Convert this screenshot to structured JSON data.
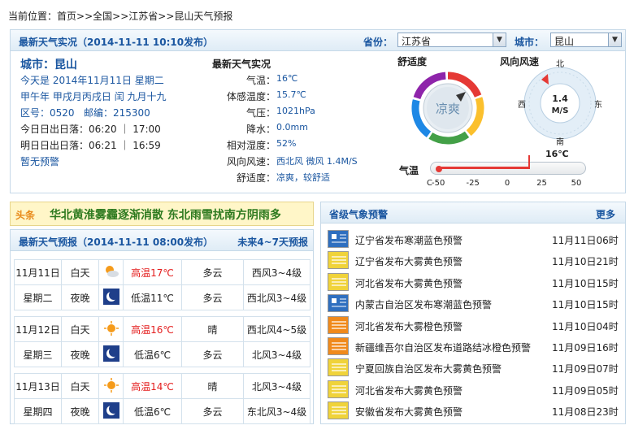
{
  "breadcrumb": {
    "prefix": "当前位置：",
    "home": "首页",
    "sep1": ">>",
    "country": "全国",
    "sep2": ">>",
    "province": "江苏省",
    "sep3": ">>",
    "current": "昆山天气预报"
  },
  "realtime": {
    "title": "最新天气实况（2014-11-11  10:10发布）",
    "province_label": "省份：",
    "province_value": "江苏省",
    "city_label": "城市：",
    "city_value": "昆山",
    "city_name": "城市：昆山",
    "today_label": "今天是",
    "today_date": "2014年11月11日",
    "today_week": "星期二",
    "lunar_year": "甲午年",
    "lunar_date": "甲戌月丙戌日",
    "lunar_leap": "闰",
    "lunar_md": "九月十九",
    "areacode": "区号：0520",
    "postcode": "邮编：215300",
    "sun_today": "今日日出日落：06:20 ｜ 17:00",
    "sun_tomorrow": "明日日出日落：06:21 ｜ 16:59",
    "no_warning": "暂无预警",
    "obs_title": "最新天气实况",
    "obs": [
      {
        "k": "气温：",
        "v": "16℃"
      },
      {
        "k": "体感温度：",
        "v": "15.7℃"
      },
      {
        "k": "气压：",
        "v": "1021hPa"
      },
      {
        "k": "降水：",
        "v": "0.0mm"
      },
      {
        "k": "相对湿度：",
        "v": "52%"
      },
      {
        "k": "风向风速：",
        "v": "西北风 微风 1.4M/S"
      },
      {
        "k": "舒适度：",
        "v": "凉爽，较舒适"
      }
    ],
    "comfort_title": "舒适度",
    "comfort_value": "凉爽",
    "wind_title": "风向风速",
    "wind_speed": "1.4",
    "wind_unit": "M/S",
    "dir_n": "北",
    "dir_s": "南",
    "dir_w": "西",
    "dir_e": "东",
    "temp_title": "气温",
    "temp_value": "16℃",
    "temp_unit": "C",
    "temp_ticks": [
      "-50",
      "-25",
      "0",
      "25",
      "50"
    ],
    "temp_level": 16,
    "comfort_colors": [
      "#e53935",
      "#fbc02d",
      "#43a047",
      "#1e88e5",
      "#8e24aa"
    ]
  },
  "marquee": {
    "tag": "头条",
    "text": "华北黄淮雾霾逐渐消散  东北雨雪扰南方阴雨多"
  },
  "forecast": {
    "title": "最新天气预报（2014-11-11  08:00发布）",
    "link": "未来4~7天预报",
    "days": [
      {
        "date": "11月11日",
        "week": "星期二",
        "day": {
          "label": "白天",
          "icon": "sun-cloud-icon",
          "temp": "高温17℃",
          "wx": "多云",
          "wind": "西风3~4级"
        },
        "night": {
          "label": "夜晚",
          "icon": "moon-icon",
          "temp": "低温11℃",
          "wx": "多云",
          "wind": "西北风3~4级"
        }
      },
      {
        "date": "11月12日",
        "week": "星期三",
        "day": {
          "label": "白天",
          "icon": "sun-icon",
          "temp": "高温16℃",
          "wx": "晴",
          "wind": "西北风4~5级"
        },
        "night": {
          "label": "夜晚",
          "icon": "moon-icon",
          "temp": "低温6℃",
          "wx": "多云",
          "wind": "北风3~4级"
        }
      },
      {
        "date": "11月13日",
        "week": "星期四",
        "day": {
          "label": "白天",
          "icon": "sun-icon",
          "temp": "高温14℃",
          "wx": "晴",
          "wind": "北风3~4级"
        },
        "night": {
          "label": "夜晚",
          "icon": "moon-icon",
          "temp": "低温6℃",
          "wx": "多云",
          "wind": "东北风3~4级"
        }
      }
    ]
  },
  "warnings": {
    "title": "省级气象预警",
    "more": "更多",
    "items": [
      {
        "icon": "cold-wave-blue-icon",
        "color": "#2f6fbf",
        "text": "辽宁省发布寒潮蓝色预警",
        "time": "11月11日06时"
      },
      {
        "icon": "fog-yellow-icon",
        "color": "#f0d33a",
        "text": "辽宁省发布大雾黄色预警",
        "time": "11月10日21时"
      },
      {
        "icon": "fog-yellow-icon",
        "color": "#f0d33a",
        "text": "河北省发布大雾黄色预警",
        "time": "11月10日15时"
      },
      {
        "icon": "cold-wave-blue-icon",
        "color": "#2f6fbf",
        "text": "内蒙古自治区发布寒潮蓝色预警",
        "time": "11月10日15时"
      },
      {
        "icon": "fog-orange-icon",
        "color": "#f08a1c",
        "text": "河北省发布大雾橙色预警",
        "time": "11月10日04时"
      },
      {
        "icon": "icy-road-orange-icon",
        "color": "#f08a1c",
        "text": "新疆维吾尔自治区发布道路结冰橙色预警",
        "time": "11月09日16时"
      },
      {
        "icon": "fog-yellow-icon",
        "color": "#f0d33a",
        "text": "宁夏回族自治区发布大雾黄色预警",
        "time": "11月09日07时"
      },
      {
        "icon": "fog-yellow-icon",
        "color": "#f0d33a",
        "text": "河北省发布大雾黄色预警",
        "time": "11月09日05时"
      },
      {
        "icon": "fog-yellow-icon",
        "color": "#f0d33a",
        "text": "安徽省发布大雾黄色预警",
        "time": "11月08日23时"
      }
    ]
  }
}
